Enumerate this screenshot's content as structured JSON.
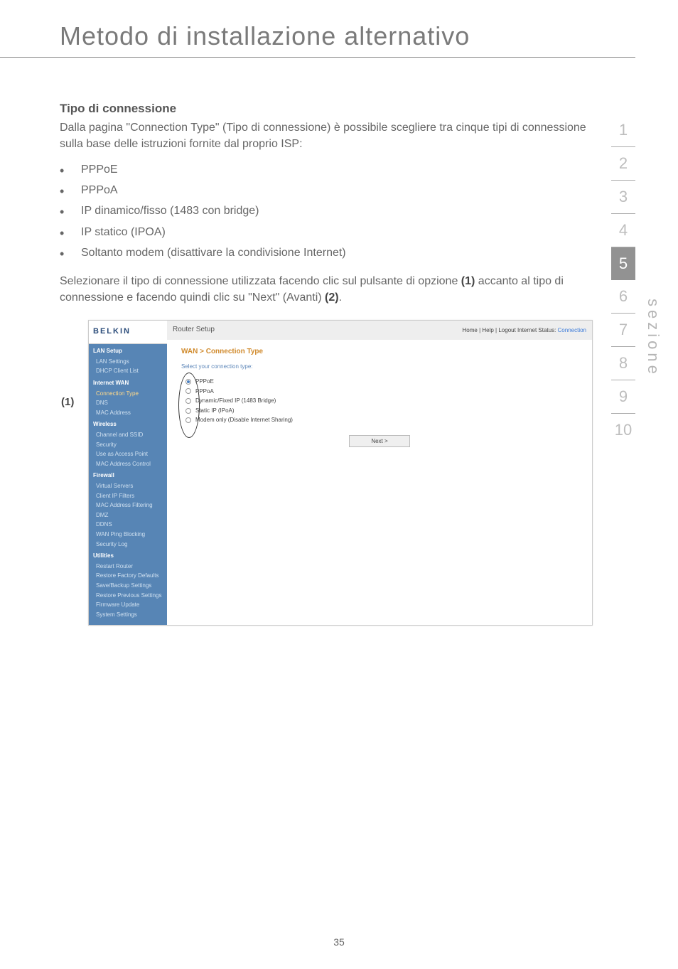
{
  "page": {
    "title": "Metodo di installazione alternativo",
    "number": "35"
  },
  "nav": {
    "items": [
      "1",
      "2",
      "3",
      "4",
      "5",
      "6",
      "7",
      "8",
      "9",
      "10"
    ],
    "active_index": 4,
    "vertical_label": "sezione"
  },
  "body": {
    "heading": "Tipo di connessione",
    "intro": "Dalla pagina \"Connection Type\" (Tipo di connessione) è possibile scegliere tra cinque tipi di connessione sulla base delle istruzioni fornite dal proprio ISP:",
    "bullets": [
      "PPPoE",
      "PPPoA",
      "IP dinamico/fisso (1483 con bridge)",
      "IP statico (IPOA)",
      "Soltanto modem (disattivare la condivisione Internet)"
    ],
    "para_pre": "Selezionare il tipo di connessione utilizzata facendo clic sul pulsante di opzione ",
    "ref1": "(1)",
    "para_mid": " accanto al tipo di connessione e facendo quindi clic su \"Next\" (Avanti)  ",
    "ref2": "(2)",
    "para_end": "."
  },
  "screenshot": {
    "marker": "(1)",
    "logo": "BELKIN",
    "topbar_title": "Router Setup",
    "topbar_right_links": "Home | Help | Logout   Internet Status:",
    "topbar_status": " Connection",
    "sidebar": {
      "s1_title": "LAN Setup",
      "s1_items": [
        "LAN Settings",
        "DHCP Client List"
      ],
      "s2_title": "Internet WAN",
      "s2_items": [
        "Connection Type",
        "DNS",
        "MAC Address"
      ],
      "s3_title": "Wireless",
      "s3_items": [
        "Channel and SSID",
        "Security",
        "Use as Access Point",
        "MAC Address Control"
      ],
      "s4_title": "Firewall",
      "s4_items": [
        "Virtual Servers",
        "Client IP Filters",
        "MAC Address Filtering",
        "DMZ",
        "DDNS",
        "WAN Ping Blocking",
        "Security Log"
      ],
      "s5_title": "Utilities",
      "s5_items": [
        "Restart Router",
        "Restore Factory Defaults",
        "Save/Backup Settings",
        "Restore Previous Settings",
        "Firmware Update",
        "System Settings"
      ]
    },
    "main": {
      "crumb": "WAN > Connection Type",
      "subline": "Select your connection type:",
      "radios": [
        "PPPoE",
        "PPPoA",
        "Dynamic/Fixed IP (1483 Bridge)",
        "Static IP (IPoA)",
        "Modem only (Disable Internet Sharing)"
      ],
      "next_label": "Next >"
    }
  }
}
